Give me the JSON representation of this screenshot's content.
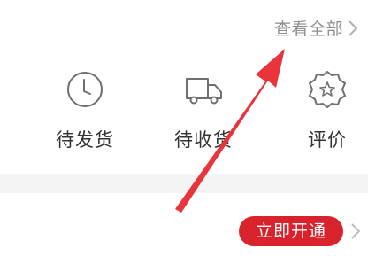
{
  "header": {
    "view_all_label": "查看全部"
  },
  "orders": {
    "items": [
      {
        "label": "待发货",
        "icon": "clock-icon"
      },
      {
        "label": "待收货",
        "icon": "truck-icon"
      },
      {
        "label": "评价",
        "icon": "star-badge-icon"
      }
    ]
  },
  "membership": {
    "open_now_label": "立即开通"
  },
  "colors": {
    "accent": "#d9232c",
    "arrow": "#e8343a",
    "muted_text": "#8e8e8e",
    "label_text": "#333333",
    "icon_stroke": "#6f6f6f"
  }
}
